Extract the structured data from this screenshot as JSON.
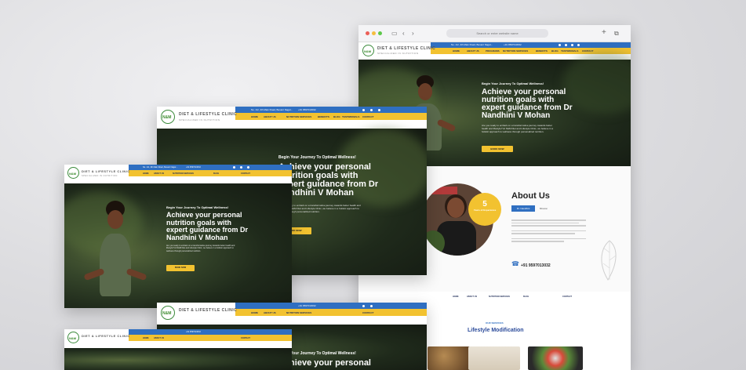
{
  "brand": {
    "logo_mark": "N&M",
    "title": "DIET & LIFESTYLE CLINIC",
    "subtitle": "SPECIALIZED IN NUTRITION"
  },
  "topbar": {
    "address": "No. 1/2, 4th Main Road, Besant Nagar...",
    "phone": "+91 9597013032"
  },
  "nav": [
    "HOME",
    "ABOUT US",
    "PROGRAMS",
    "NUTRITION SERVICES",
    "BENEFITS",
    "BLOG",
    "TESTIMONIALS",
    "CONTACT"
  ],
  "hero": {
    "kicker": "Begin Your Journey To Optimal Wellness!",
    "headline": "Achieve your personal nutrition goals with expert guidance from Dr Nandhini V Mohan",
    "headline_short_a": "Achieve your personal",
    "headline_short_b": "nutrition goals with",
    "headline_short_c": "expert guidance from Dr",
    "headline_short_d": "Nandhini V Mohan",
    "body": "Are you ready to embark on a transformative journey towards better health and lifestyle? At N&M Diet and Lifestyle Clinic, we believe in a holistic approach to wellness through personalized nutrition.",
    "cta": "BOOK NOW"
  },
  "browser": {
    "address": "Search or enter website name",
    "colors": {
      "close": "#ec5f57",
      "min": "#f5be3f",
      "max": "#5dc84a"
    }
  },
  "about": {
    "title": "About Us",
    "badge_number": "5",
    "badge_label": "Years of Experience",
    "tab_active": "Dr. Nandhini",
    "tab_other": "Mission",
    "phone": "+91 9597013032"
  },
  "lifestyle": {
    "kicker": "OUR SERVICES",
    "title": "Lifestyle Modification"
  },
  "colors": {
    "accent_blue": "#2f6fc1",
    "accent_yellow": "#f2c230",
    "dark_green": "#1f2a1b"
  }
}
